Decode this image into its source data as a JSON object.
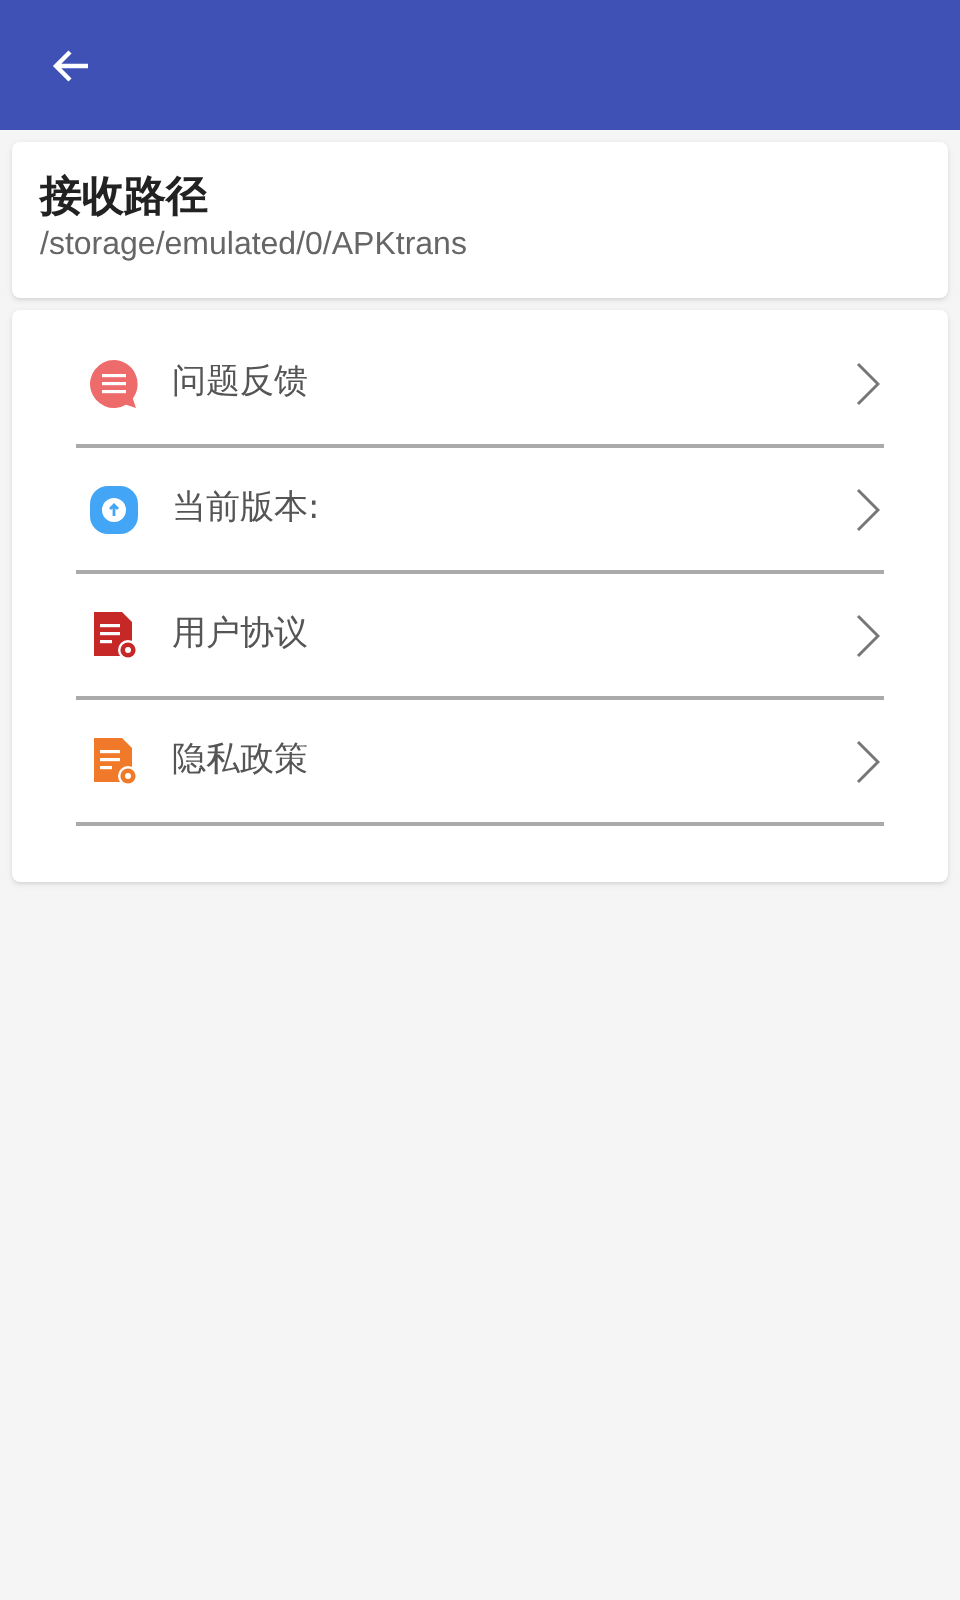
{
  "path_card": {
    "title": "接收路径",
    "path": "/storage/emulated/0/APKtrans"
  },
  "menu": [
    {
      "kind": "feedback",
      "label": "问题反馈"
    },
    {
      "kind": "version",
      "label": "当前版本:"
    },
    {
      "kind": "agreement",
      "label": "用户协议"
    },
    {
      "kind": "privacy",
      "label": "隐私政策"
    }
  ]
}
